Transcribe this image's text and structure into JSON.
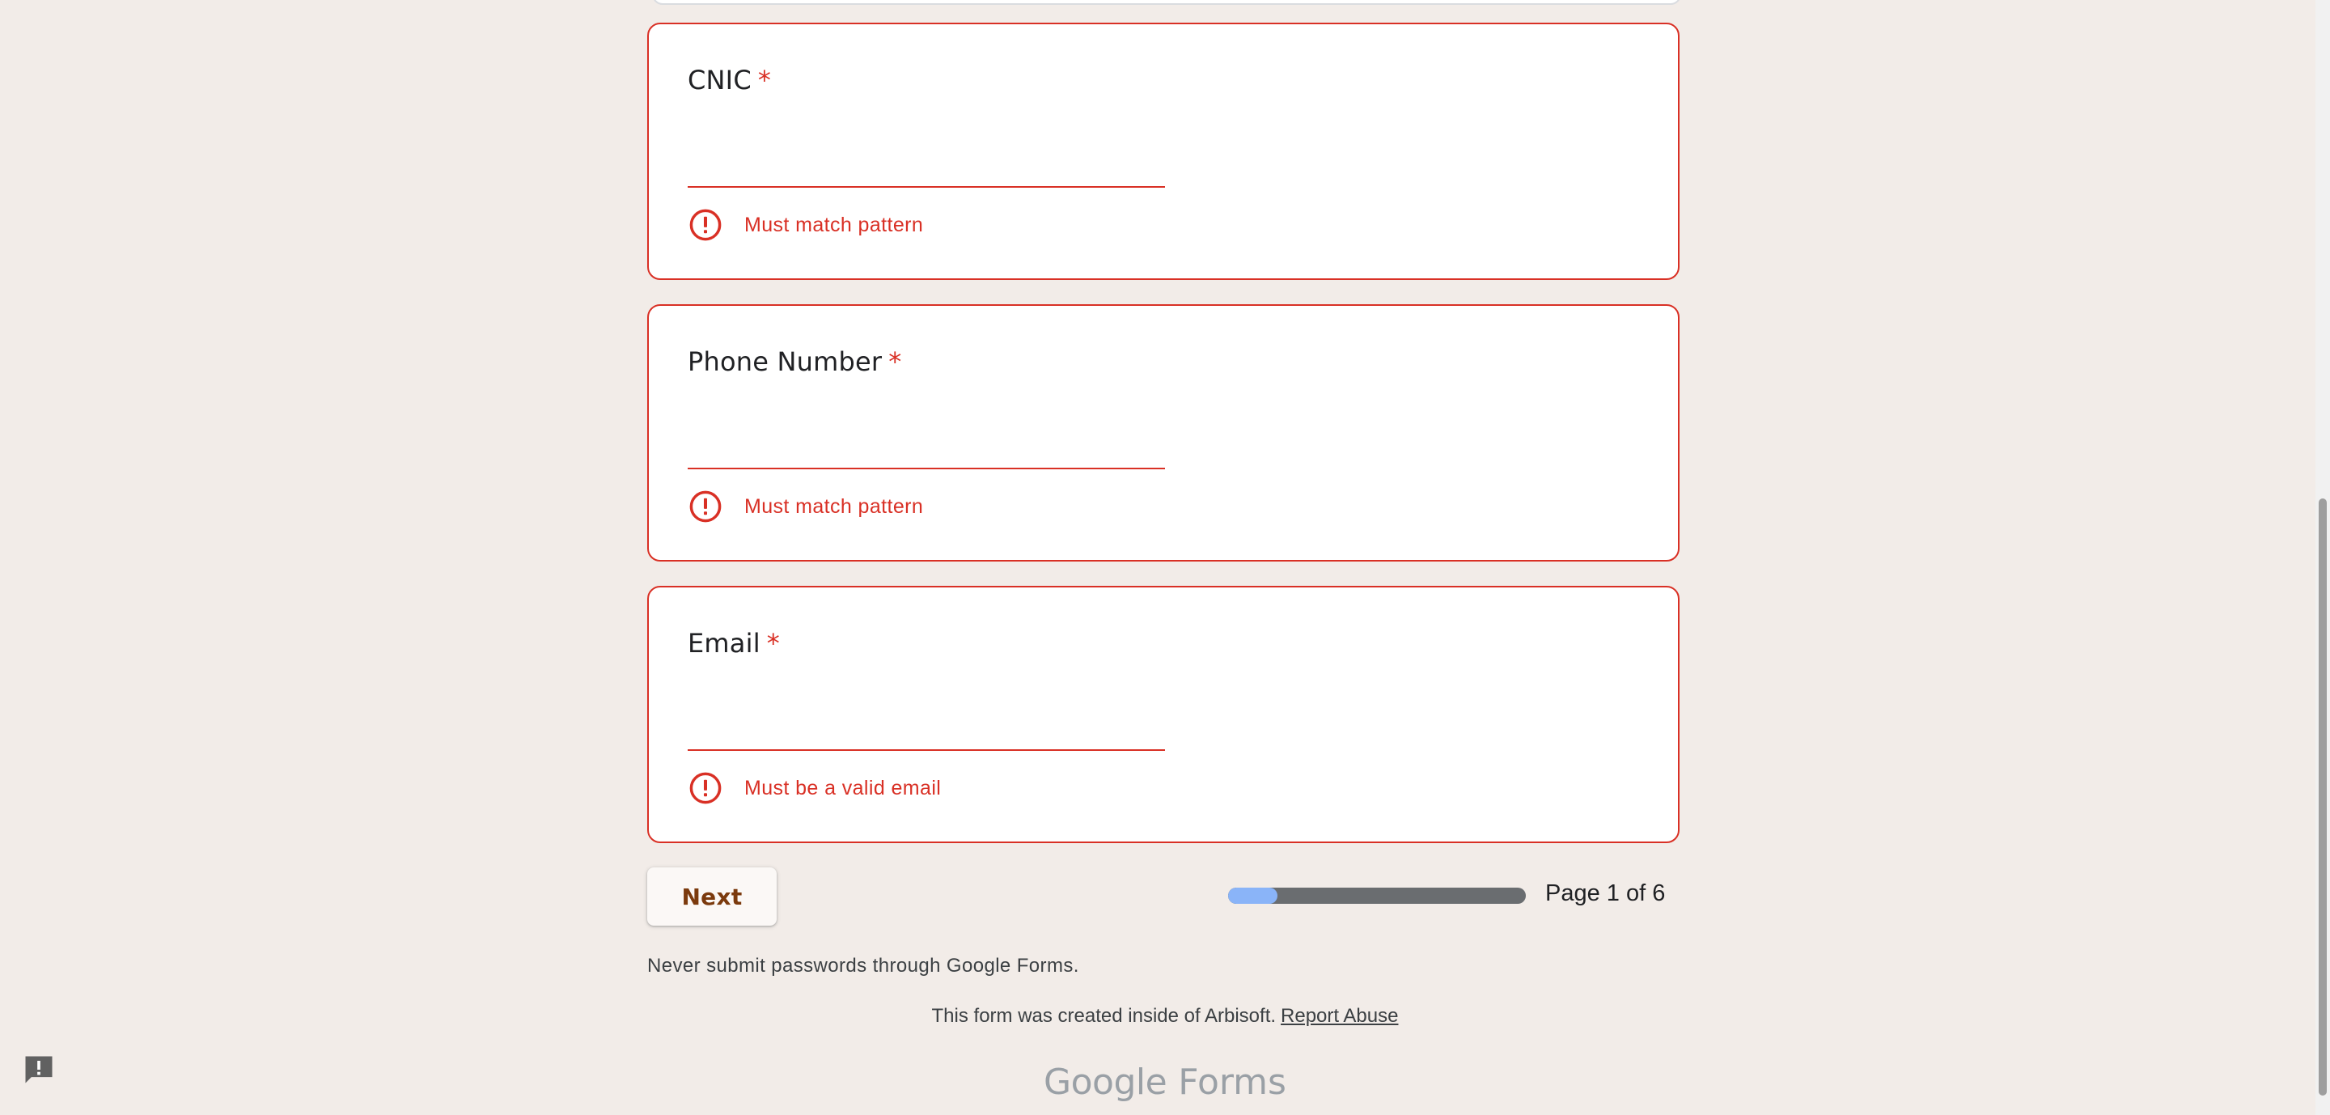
{
  "questions": [
    {
      "title": "CNIC",
      "required_marker": "*",
      "value": "",
      "error": "Must match pattern"
    },
    {
      "title": "Phone Number",
      "required_marker": "*",
      "value": "",
      "error": "Must match pattern"
    },
    {
      "title": "Email",
      "required_marker": "*",
      "value": "",
      "error": "Must be a valid email"
    }
  ],
  "navigation": {
    "next_label": "Next",
    "page_label": "Page 1 of 6",
    "progress_fraction": 0.1667
  },
  "footer": {
    "password_warning": "Never submit passwords through Google Forms.",
    "created_text": "This form was created inside of Arbisoft.",
    "report_abuse_label": "Report Abuse",
    "brand_google": "Google",
    "brand_forms": "Forms"
  },
  "icons": {
    "error": "error-circle-icon",
    "feedback": "report-feedback-icon"
  },
  "colors": {
    "background": "#f2ece8",
    "error": "#d93025",
    "button_text": "#7b3a0d",
    "progress_fill": "#8ab4f8",
    "progress_track": "#6a6d70"
  }
}
